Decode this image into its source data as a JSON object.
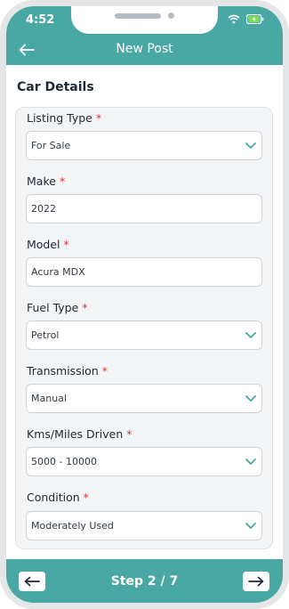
{
  "status_bar": {
    "time": "4:52"
  },
  "header": {
    "title": "New Post"
  },
  "section": {
    "title": "Car Details"
  },
  "required_marker": "*",
  "fields": [
    {
      "label": "Listing Type",
      "value": "For Sale",
      "type": "select"
    },
    {
      "label": "Make",
      "value": "2022",
      "type": "input"
    },
    {
      "label": "Model",
      "value": "Acura MDX",
      "type": "input"
    },
    {
      "label": "Fuel Type",
      "value": "Petrol",
      "type": "select"
    },
    {
      "label": "Transmission",
      "value": "Manual",
      "type": "select"
    },
    {
      "label": "Kms/Miles Driven",
      "value": "5000 - 10000",
      "type": "select"
    },
    {
      "label": "Condition",
      "value": "Moderately Used",
      "type": "select"
    }
  ],
  "footer": {
    "step": "Step 2 / 7"
  },
  "colors": {
    "accent": "#4aa8a4",
    "required": "#d63a3a"
  }
}
